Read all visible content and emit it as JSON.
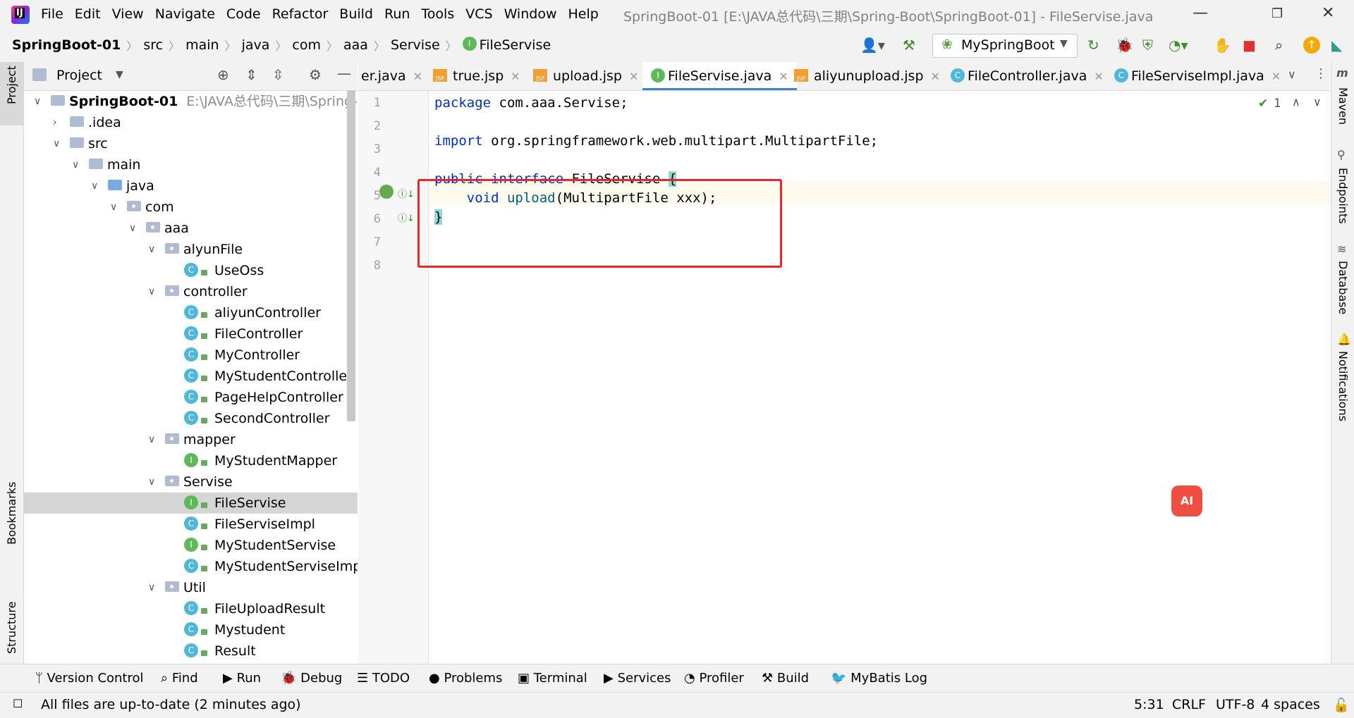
{
  "menu": [
    "File",
    "Edit",
    "View",
    "Navigate",
    "Code",
    "Refactor",
    "Build",
    "Run",
    "Tools",
    "VCS",
    "Window",
    "Help"
  ],
  "window_title": "SpringBoot-01 [E:\\JAVA总代码\\三期\\Spring-Boot\\SpringBoot-01] - FileServise.java",
  "breadcrumbs": [
    "SpringBoot-01",
    "src",
    "main",
    "java",
    "com",
    "aaa",
    "Servise",
    "FileServise"
  ],
  "run_config": "MySpringBoot",
  "project_panel": {
    "title": "Project"
  },
  "tree": [
    {
      "label": "SpringBoot-01",
      "path": "E:\\JAVA总代码\\三期\\Spring-Boo",
      "kind": "module",
      "depth": 0,
      "open": true
    },
    {
      "label": ".idea",
      "kind": "folder",
      "depth": 1,
      "open": false
    },
    {
      "label": "src",
      "kind": "folder",
      "depth": 1,
      "open": true
    },
    {
      "label": "main",
      "kind": "folder",
      "depth": 2,
      "open": true
    },
    {
      "label": "java",
      "kind": "source",
      "depth": 3,
      "open": true
    },
    {
      "label": "com",
      "kind": "package",
      "depth": 4,
      "open": true
    },
    {
      "label": "aaa",
      "kind": "package",
      "depth": 5,
      "open": true
    },
    {
      "label": "alyunFile",
      "kind": "package",
      "depth": 6,
      "open": true
    },
    {
      "label": "UseOss",
      "kind": "class",
      "depth": 7
    },
    {
      "label": "controller",
      "kind": "package",
      "depth": 6,
      "open": true
    },
    {
      "label": "aliyunController",
      "kind": "class",
      "depth": 7
    },
    {
      "label": "FileController",
      "kind": "class",
      "depth": 7
    },
    {
      "label": "MyController",
      "kind": "class",
      "depth": 7
    },
    {
      "label": "MyStudentController",
      "kind": "class",
      "depth": 7
    },
    {
      "label": "PageHelpController",
      "kind": "class",
      "depth": 7
    },
    {
      "label": "SecondController",
      "kind": "class",
      "depth": 7
    },
    {
      "label": "mapper",
      "kind": "package",
      "depth": 6,
      "open": true
    },
    {
      "label": "MyStudentMapper",
      "kind": "interface",
      "depth": 7
    },
    {
      "label": "Servise",
      "kind": "package",
      "depth": 6,
      "open": true
    },
    {
      "label": "FileServise",
      "kind": "interface",
      "depth": 7,
      "selected": true
    },
    {
      "label": "FileServiseImpl",
      "kind": "class",
      "depth": 7
    },
    {
      "label": "MyStudentServise",
      "kind": "interface",
      "depth": 7
    },
    {
      "label": "MyStudentServiseImpl",
      "kind": "class",
      "depth": 7
    },
    {
      "label": "Util",
      "kind": "package",
      "depth": 6,
      "open": true
    },
    {
      "label": "FileUploadResult",
      "kind": "class",
      "depth": 7
    },
    {
      "label": "Mystudent",
      "kind": "class",
      "depth": 7
    },
    {
      "label": "Result",
      "kind": "class",
      "depth": 7
    }
  ],
  "tabs": [
    {
      "label": "er.java",
      "kind": "java"
    },
    {
      "label": "true.jsp",
      "kind": "jsp"
    },
    {
      "label": "upload.jsp",
      "kind": "jsp"
    },
    {
      "label": "FileServise.java",
      "kind": "interface",
      "active": true
    },
    {
      "label": "aliyunupload.jsp",
      "kind": "jsp"
    },
    {
      "label": "FileController.java",
      "kind": "class"
    },
    {
      "label": "FileServiseImpl.java",
      "kind": "class"
    }
  ],
  "editor": {
    "line_numbers": [
      "1",
      "2",
      "3",
      "4",
      "5",
      "6",
      "7",
      "8"
    ],
    "inspection_count": "1",
    "lines": [
      {
        "n": 1,
        "parts": [
          {
            "t": "package",
            "c": "kw"
          },
          {
            "t": " com.aaa.Servise;",
            "c": ""
          }
        ]
      },
      {
        "n": 2,
        "parts": []
      },
      {
        "n": 3,
        "parts": [
          {
            "t": "import",
            "c": "kw"
          },
          {
            "t": " org.springframework.web.multipart.MultipartFile;",
            "c": ""
          }
        ]
      },
      {
        "n": 4,
        "parts": []
      },
      {
        "n": 5,
        "parts": [
          {
            "t": "public",
            "c": "kw"
          },
          {
            "t": " ",
            "c": ""
          },
          {
            "t": "interface",
            "c": "kw"
          },
          {
            "t": " FileServise ",
            "c": ""
          },
          {
            "t": "{",
            "c": "brace"
          }
        ]
      },
      {
        "n": 6,
        "parts": [
          {
            "t": "    ",
            "c": ""
          },
          {
            "t": "void",
            "c": "kw"
          },
          {
            "t": " ",
            "c": ""
          },
          {
            "t": "upload",
            "c": "fn"
          },
          {
            "t": "(MultipartFile xxx);",
            "c": ""
          }
        ]
      },
      {
        "n": 7,
        "parts": [
          {
            "t": "}",
            "c": "brace"
          }
        ]
      },
      {
        "n": 8,
        "parts": []
      }
    ]
  },
  "left_stripe": [
    "Project",
    "Bookmarks",
    "Structure"
  ],
  "right_stripe": [
    "Maven",
    "Endpoints",
    "Database",
    "Notifications"
  ],
  "tool_windows": [
    "Version Control",
    "Find",
    "Run",
    "Debug",
    "TODO",
    "Problems",
    "Terminal",
    "Services",
    "Profiler",
    "Build",
    "MyBatis Log"
  ],
  "status": {
    "message": "All files are up-to-date (2 minutes ago)",
    "position": "5:31",
    "line_sep": "CRLF",
    "encoding": "UTF-8",
    "indent": "4 spaces"
  },
  "ai_button": "AI",
  "colors": {
    "keyword": "#0033b3",
    "function": "#00627a",
    "highlight_box": "#e8262b",
    "accent": "#4083c9"
  }
}
